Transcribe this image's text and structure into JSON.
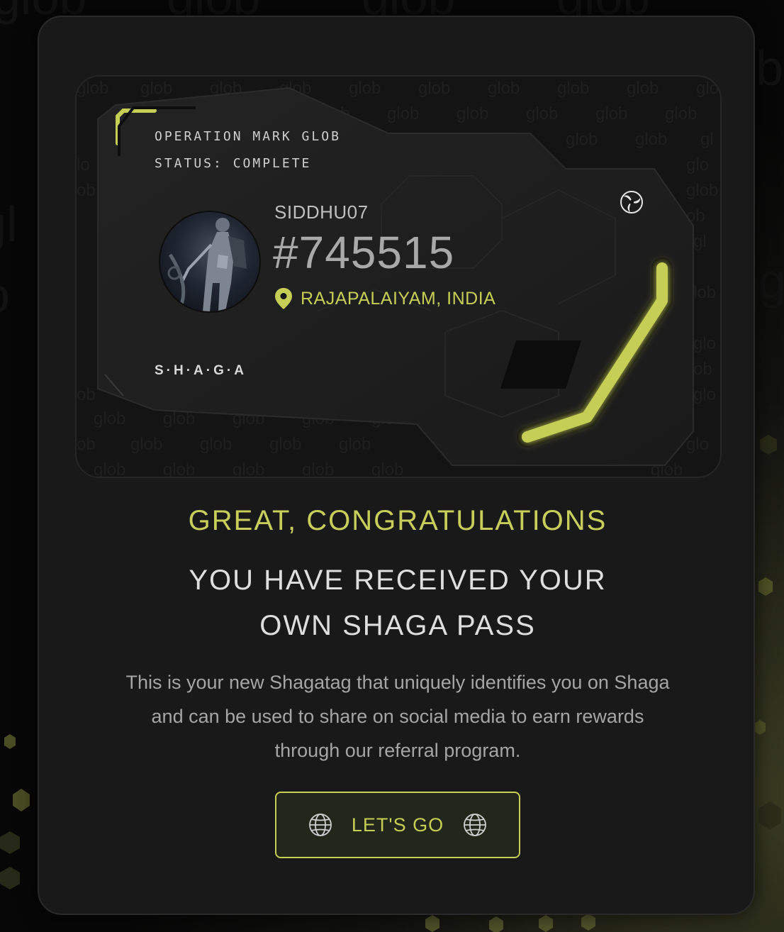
{
  "pass_card": {
    "operation_title": "OPERATION MARK GLOB",
    "status": "STATUS: COMPLETE",
    "username": "SIDDHU07",
    "pass_number": "#745515",
    "location": "RAJAPALAIYAM, INDIA",
    "brand": "S·H·A·G·A",
    "watermark_word": "glob",
    "icons": {
      "location": "map-pin-icon",
      "emblem": "triskelion-logo-icon",
      "avatar": "armored-archer-avatar"
    }
  },
  "content": {
    "congrats": "GREAT, CONGRATULATIONS",
    "received_line1": "YOU HAVE RECEIVED YOUR",
    "received_line2": "OWN SHAGA PASS",
    "description": "This is your new Shagatag that uniquely identifies you on Shaga and can be used to share on social media to earn rewards through our referral program."
  },
  "cta": {
    "label": "LET'S GO",
    "icon": "globe-icon"
  },
  "colors": {
    "accent": "#c6cf55",
    "modal_bg": "#191919",
    "card_bg": "#141414",
    "text_primary": "#dedede",
    "text_muted": "#a5a5a5"
  }
}
